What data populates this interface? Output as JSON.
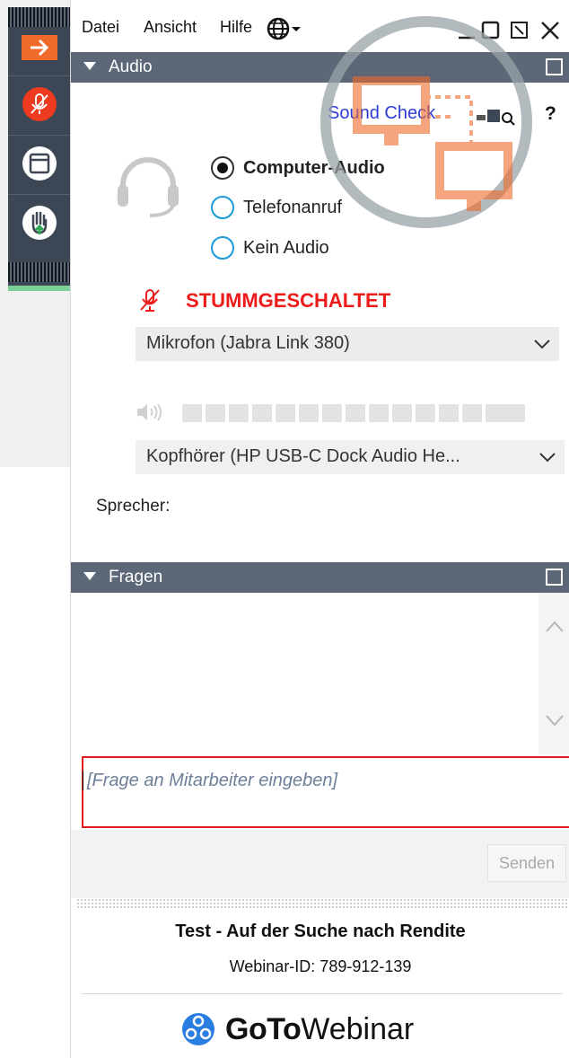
{
  "menu": {
    "datei": "Datei",
    "ansicht": "Ansicht",
    "hilfe": "Hilfe"
  },
  "audio_section": {
    "title": "Audio",
    "sound_check": "Sound Check",
    "help": "?",
    "options": [
      {
        "label": "Computer-Audio",
        "selected": true
      },
      {
        "label": "Telefonanruf",
        "selected": false
      },
      {
        "label": "Kein Audio",
        "selected": false
      }
    ],
    "mute_status": "STUMMGESCHALTET",
    "microphone": "Mikrofon (Jabra Link 380)",
    "speaker_device": "Kopfhörer (HP USB-C Dock Audio He...",
    "speaker_label": "Sprecher:"
  },
  "questions_section": {
    "title": "Fragen",
    "input_placeholder": "[Frage an Mitarbeiter eingeben]",
    "send_label": "Senden"
  },
  "footer": {
    "webinar_title": "Test - Auf der Suche nach Rendite",
    "webinar_id": "Webinar-ID: 789-912-139",
    "brand_goto": "GoTo",
    "brand_webinar": "Webinar"
  },
  "colors": {
    "header": "#5c6778",
    "toolbar": "#3c4654",
    "mute_red": "#ee1b1b",
    "accent_orange": "#f06a2a",
    "link_blue": "#2d3bd6"
  }
}
